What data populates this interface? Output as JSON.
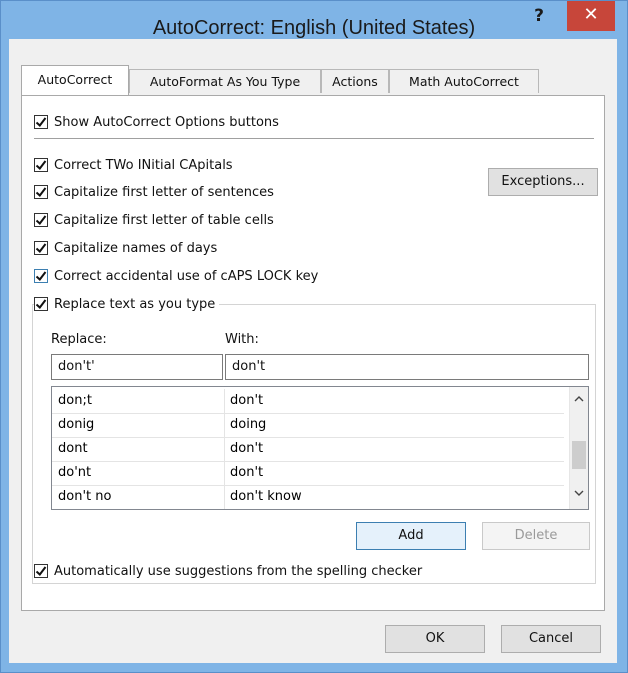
{
  "window": {
    "title": "AutoCorrect: English (United States)",
    "help_label": "?",
    "close_label": "✕"
  },
  "tabs": [
    {
      "label": "AutoCorrect"
    },
    {
      "label": "AutoFormat As You Type"
    },
    {
      "label": "Actions"
    },
    {
      "label": "Math AutoCorrect"
    }
  ],
  "options": {
    "show_buttons": {
      "label": "Show AutoCorrect Options buttons",
      "checked": true
    },
    "two_initial_caps": {
      "label": "Correct TWo INitial CApitals",
      "checked": true
    },
    "first_letter_sentences": {
      "label": "Capitalize first letter of sentences",
      "checked": true
    },
    "first_letter_cells": {
      "label": "Capitalize first letter of table cells",
      "checked": true
    },
    "names_of_days": {
      "label": "Capitalize names of days",
      "checked": true
    },
    "caps_lock": {
      "label": "Correct accidental use of cAPS LOCK key",
      "checked": true
    },
    "replace_text": {
      "label": "Replace text as you type",
      "checked": true
    },
    "spelling_suggestions": {
      "label": "Automatically use suggestions from the spelling checker",
      "checked": true
    }
  },
  "buttons": {
    "exceptions": "Exceptions...",
    "add": "Add",
    "delete": "Delete",
    "ok": "OK",
    "cancel": "Cancel"
  },
  "replace": {
    "replace_label": "Replace:",
    "with_label": "With:",
    "replace_value": "don't'",
    "with_value": "don't",
    "entries": [
      {
        "replace": "don;t",
        "with": "don't"
      },
      {
        "replace": "donig",
        "with": "doing"
      },
      {
        "replace": "dont",
        "with": "don't"
      },
      {
        "replace": "do'nt",
        "with": "don't"
      },
      {
        "replace": "don't no",
        "with": "don't know"
      }
    ]
  },
  "icons": {
    "check": "checkmark-icon",
    "scroll_up": "chevron-up-icon",
    "scroll_down": "chevron-down-icon"
  },
  "colors": {
    "title_bar": "#7fb4e6",
    "close_button": "#c7463a",
    "dialog_bg": "#f0f0f0"
  }
}
